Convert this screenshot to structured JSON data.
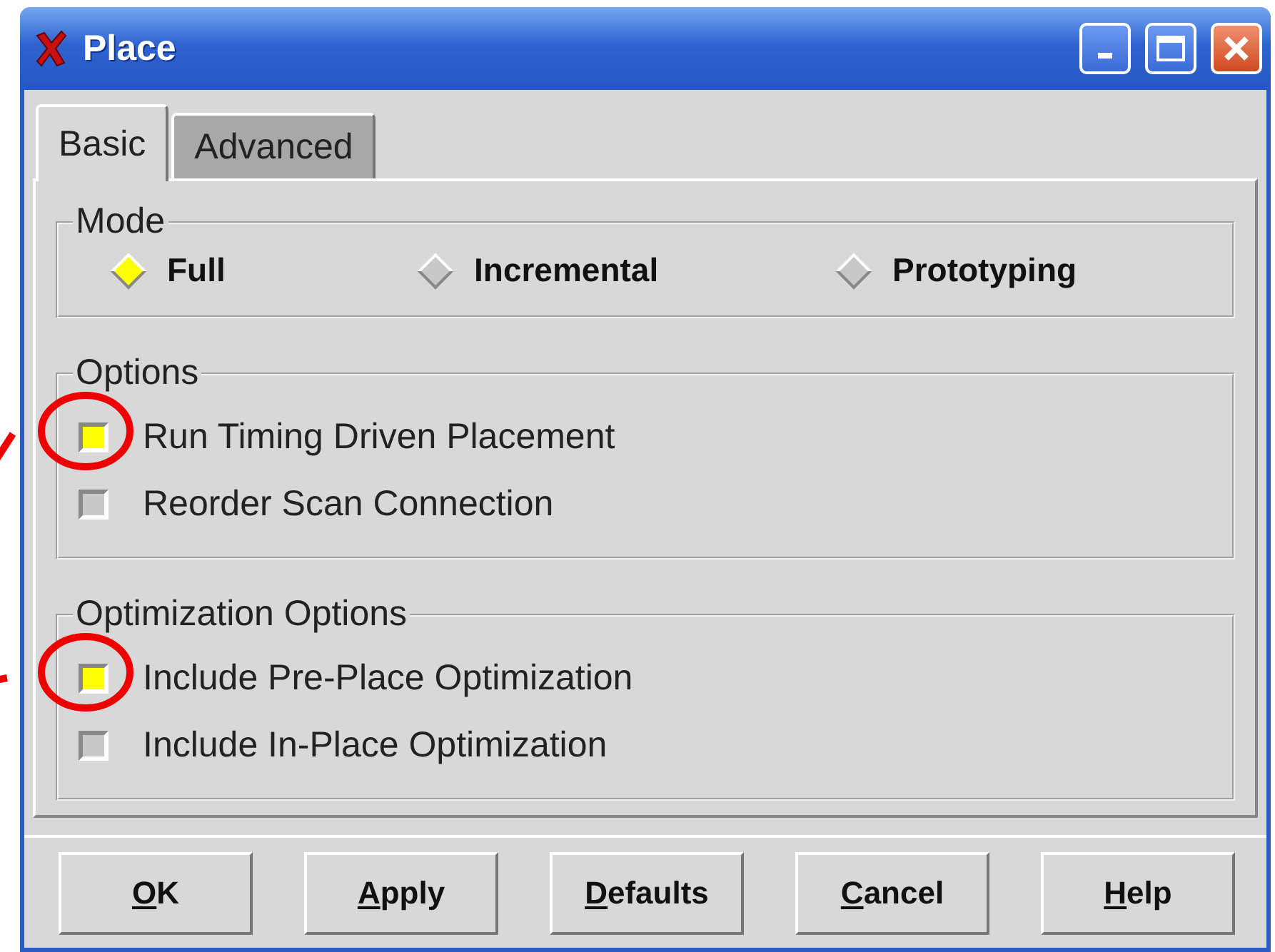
{
  "window": {
    "title": "Place"
  },
  "tabs": [
    {
      "label": "Basic",
      "selected": true
    },
    {
      "label": "Advanced",
      "selected": false
    }
  ],
  "groups": [
    {
      "title": "Mode",
      "kind": "radio",
      "items": [
        {
          "label": "Full",
          "selected": true
        },
        {
          "label": "Incremental",
          "selected": false
        },
        {
          "label": "Prototyping",
          "selected": false
        }
      ]
    },
    {
      "title": "Options",
      "kind": "checkbox",
      "items": [
        {
          "label": "Run Timing Driven Placement",
          "checked": true,
          "highlighted": true
        },
        {
          "label": "Reorder Scan Connection",
          "checked": false,
          "highlighted": false
        }
      ]
    },
    {
      "title": "Optimization Options",
      "kind": "checkbox",
      "items": [
        {
          "label": "Include Pre-Place Optimization",
          "checked": true,
          "highlighted": true
        },
        {
          "label": "Include In-Place Optimization",
          "checked": false,
          "highlighted": false
        }
      ]
    }
  ],
  "buttons": [
    "OK",
    "Apply",
    "Defaults",
    "Cancel",
    "Help"
  ]
}
